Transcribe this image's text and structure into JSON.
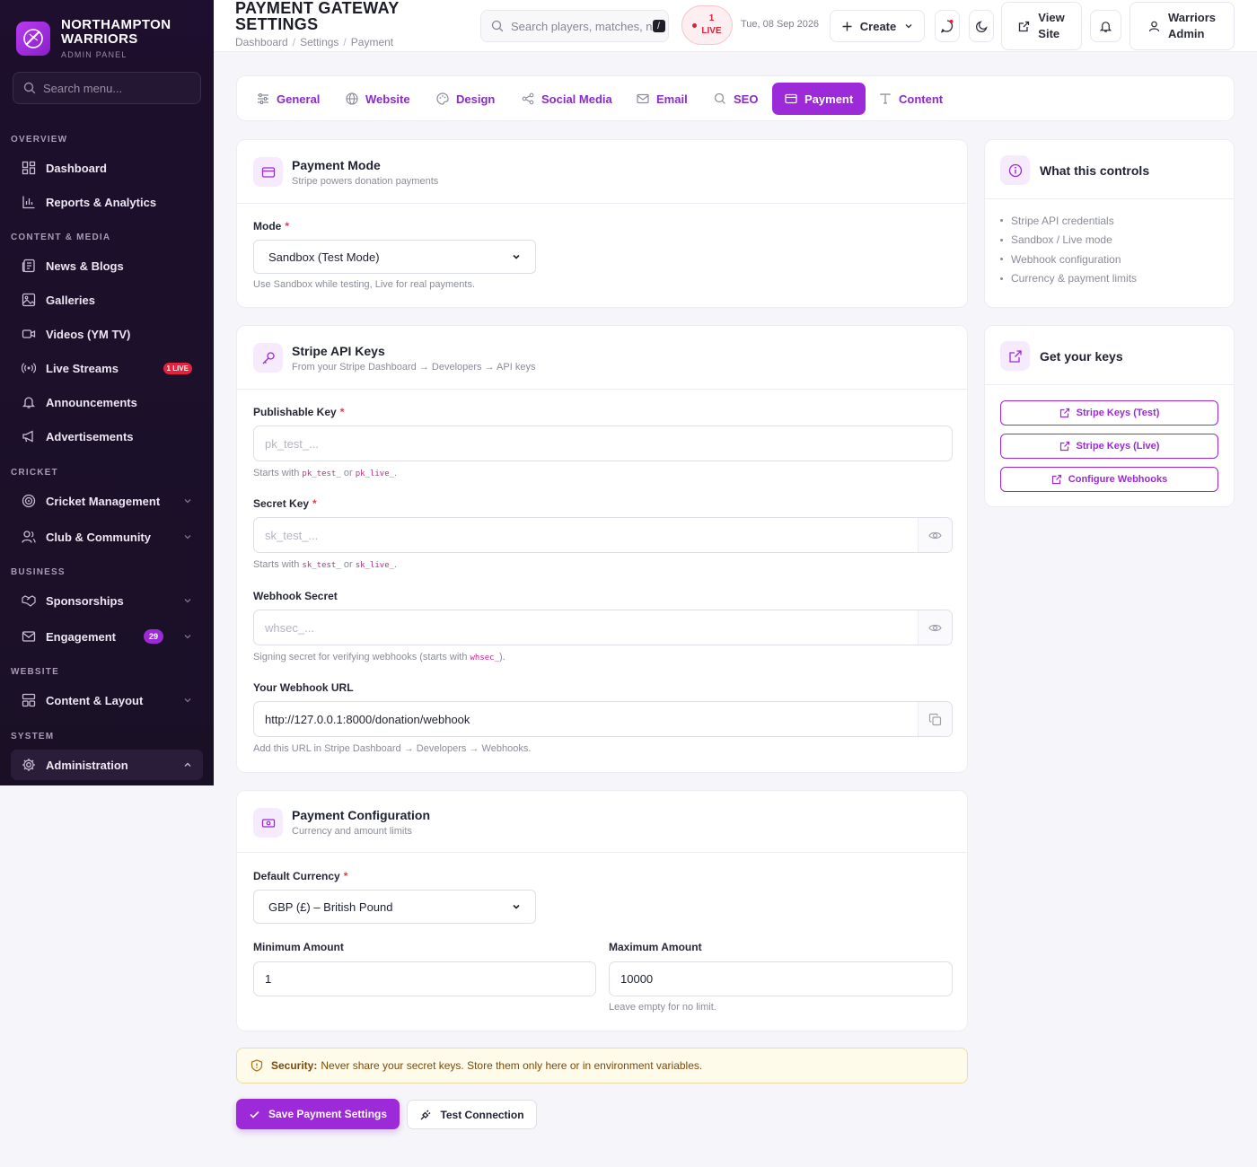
{
  "brand": {
    "name_line1": "NORTHAMPTON",
    "name_line2": "WARRIORS",
    "subtitle": "ADMIN PANEL"
  },
  "sidebar": {
    "search_placeholder": "Search menu...",
    "sections": {
      "overview": "OVERVIEW",
      "content_media": "CONTENT & MEDIA",
      "cricket": "CRICKET",
      "business": "BUSINESS",
      "website": "WEBSITE",
      "system": "SYSTEM"
    },
    "items": {
      "dashboard": "Dashboard",
      "reports": "Reports & Analytics",
      "news": "News & Blogs",
      "galleries": "Galleries",
      "videos": "Videos (YM TV)",
      "live_streams": "Live Streams",
      "live_streams_badge": "1 LIVE",
      "announcements": "Announcements",
      "advertisements": "Advertisements",
      "cricket_management": "Cricket Management",
      "club_community": "Club & Community",
      "sponsorships": "Sponsorships",
      "engagement": "Engagement",
      "engagement_badge": "29",
      "content_layout": "Content & Layout",
      "administration": "Administration"
    }
  },
  "header": {
    "title": "PAYMENT GATEWAY SETTINGS",
    "breadcrumb": [
      "Dashboard",
      "Settings",
      "Payment"
    ],
    "search_placeholder": "Search players, matches, n",
    "search_shortcut": "/",
    "live_count": "1",
    "live_label": "LIVE",
    "date": "Tue, 08 Sep 2026",
    "create_label": "Create",
    "view_site_line1": "View",
    "view_site_line2": "Site",
    "user_line1": "Warriors",
    "user_line2": "Admin"
  },
  "tabs": [
    "General",
    "Website",
    "Design",
    "Social Media",
    "Email",
    "SEO",
    "Payment",
    "Content"
  ],
  "payment_mode": {
    "title": "Payment Mode",
    "subtitle": "Stripe powers donation payments",
    "mode_label": "Mode",
    "mode_value": "Sandbox (Test Mode)",
    "mode_hint": "Use Sandbox while testing, Live for real payments."
  },
  "api_keys": {
    "title": "Stripe API Keys",
    "subtitle": "From your Stripe Dashboard → Developers → API keys",
    "publishable_label": "Publishable Key",
    "publishable_placeholder": "pk_test_...",
    "publishable_hint_pre": "Starts with",
    "publishable_code1": "pk_test_",
    "publishable_hint_or": "or",
    "publishable_code2": "pk_live_",
    "secret_label": "Secret Key",
    "secret_placeholder": "sk_test_...",
    "secret_hint_pre": "Starts with",
    "secret_code1": "sk_test_",
    "secret_hint_or": "or",
    "secret_code2": "sk_live_",
    "webhook_secret_label": "Webhook Secret",
    "webhook_secret_placeholder": "whsec_...",
    "webhook_secret_hint_pre": "Signing secret for verifying webhooks (starts with",
    "webhook_secret_code": "whsec_",
    "webhook_secret_hint_post": ").",
    "webhook_url_label": "Your Webhook URL",
    "webhook_url_value": "http://127.0.0.1:8000/donation/webhook",
    "webhook_url_hint": "Add this URL in Stripe Dashboard → Developers → Webhooks."
  },
  "payment_config": {
    "title": "Payment Configuration",
    "subtitle": "Currency and amount limits",
    "currency_label": "Default Currency",
    "currency_value": "GBP (£) – British Pound",
    "min_label": "Minimum Amount",
    "min_value": "1",
    "max_label": "Maximum Amount",
    "max_value": "10000",
    "max_hint": "Leave empty for no limit."
  },
  "controls_panel": {
    "title": "What this controls",
    "items": [
      "Stripe API credentials",
      "Sandbox / Live mode",
      "Webhook configuration",
      "Currency & payment limits"
    ]
  },
  "keys_panel": {
    "title": "Get your keys",
    "buttons": [
      "Stripe Keys (Test)",
      "Stripe Keys (Live)",
      "Configure Webhooks"
    ]
  },
  "security_alert": {
    "label": "Security:",
    "text": "Never share your secret keys. Store them only here or in environment variables."
  },
  "actions": {
    "save": "Save Payment Settings",
    "test": "Test Connection"
  },
  "colors": {
    "accent": "#9d2ad8",
    "sidebar_bg": "#1d0f2d",
    "live_red": "#e5223d",
    "warning_bg": "#fffbea"
  }
}
